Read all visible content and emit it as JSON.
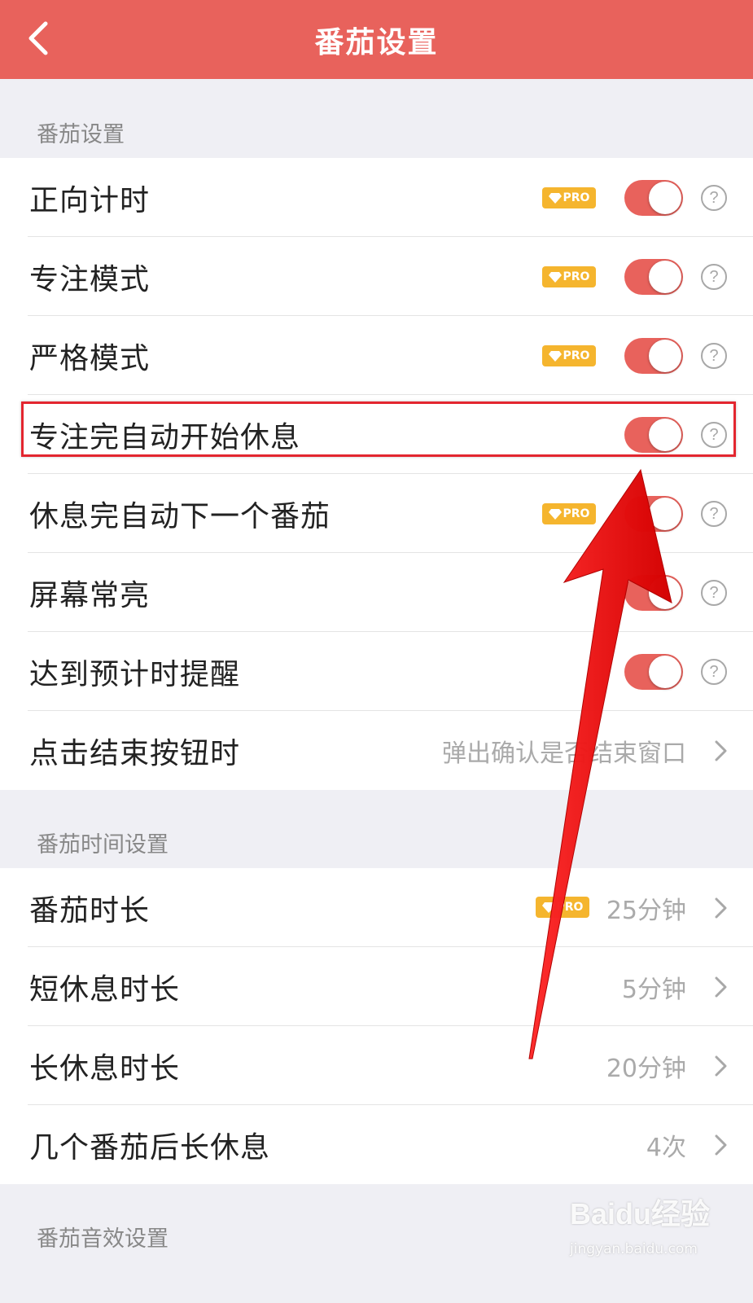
{
  "header": {
    "title": "番茄设置",
    "back_icon": "chevron-left-icon"
  },
  "colors": {
    "accent": "#e8625c",
    "pro_badge": "#f5b52e",
    "highlight": "#e3262f"
  },
  "sections": [
    {
      "title": "番茄设置",
      "rows": [
        {
          "label": "正向计时",
          "pro": true,
          "toggle": "on",
          "help": "?"
        },
        {
          "label": "专注模式",
          "pro": true,
          "toggle": "on",
          "help": "?"
        },
        {
          "label": "严格模式",
          "pro": true,
          "toggle": "on",
          "help": "?"
        },
        {
          "label": "专注完自动开始休息",
          "pro": false,
          "toggle": "on",
          "help": "?"
        },
        {
          "label": "休息完自动下一个番茄",
          "pro": true,
          "toggle": "on",
          "help": "?"
        },
        {
          "label": "屏幕常亮",
          "pro": false,
          "toggle": "on",
          "help": "?"
        },
        {
          "label": "达到预计时提醒",
          "pro": false,
          "toggle": "on",
          "help": "?"
        },
        {
          "label": "点击结束按钮时",
          "value": "弹出确认是否结束窗口"
        }
      ]
    },
    {
      "title": "番茄时间设置",
      "rows": [
        {
          "label": "番茄时长",
          "pro": true,
          "value": "25分钟"
        },
        {
          "label": "短休息时长",
          "value": "5分钟"
        },
        {
          "label": "长休息时长",
          "value": "20分钟"
        },
        {
          "label": "几个番茄后长休息",
          "value": "4次"
        }
      ]
    },
    {
      "title": "番茄音效设置"
    }
  ],
  "pro_badge_label": "PRO",
  "watermark": {
    "brand": "Baidu经验",
    "url": "jingyan.baidu.com"
  }
}
